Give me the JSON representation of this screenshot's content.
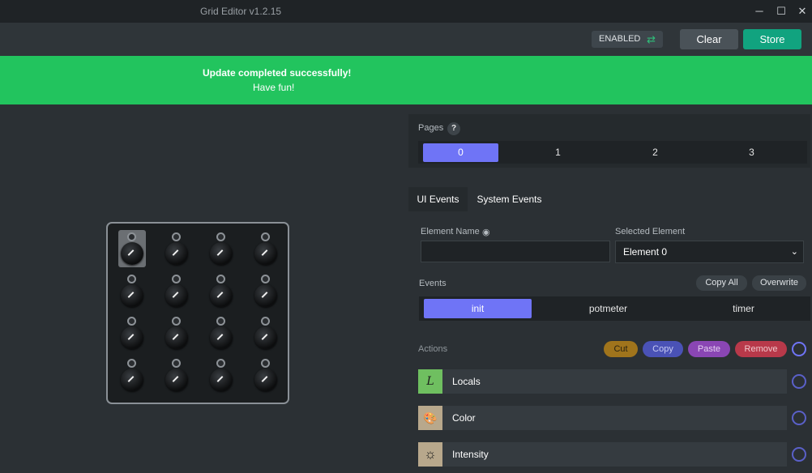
{
  "window": {
    "title": "Grid Editor v1.2.15",
    "minimize": "─",
    "maximize": "☐",
    "close": "✕"
  },
  "toolbar": {
    "enabled_label": "ENABLED",
    "swap_icon": "⇄",
    "clear_label": "Clear",
    "store_label": "Store"
  },
  "banner": {
    "line1": "Update completed successfully!",
    "line2": "Have fun!"
  },
  "pages": {
    "label": "Pages",
    "help": "?",
    "items": [
      "0",
      "1",
      "2",
      "3"
    ],
    "selected": "0"
  },
  "tabs": [
    "UI Events",
    "System Events"
  ],
  "element": {
    "name_label": "Element Name",
    "eye_icon": "◉",
    "name_value": "",
    "selected_label": "Selected Element",
    "selected_value": "Element 0",
    "chevron": "⌄"
  },
  "events": {
    "label": "Events",
    "copy_all": "Copy All",
    "overwrite": "Overwrite",
    "items": [
      "init",
      "potmeter",
      "timer"
    ],
    "selected": "init"
  },
  "actions": {
    "label": "Actions",
    "cut": "Cut",
    "copy": "Copy",
    "paste": "Paste",
    "remove": "Remove",
    "items": [
      {
        "name": "Locals",
        "icon": "L"
      },
      {
        "name": "Color",
        "icon": "🎨"
      },
      {
        "name": "Intensity",
        "icon": "☼"
      }
    ]
  },
  "colors": {
    "accent": "#6f74f6",
    "success": "#22c45e",
    "store": "#11a37f"
  }
}
